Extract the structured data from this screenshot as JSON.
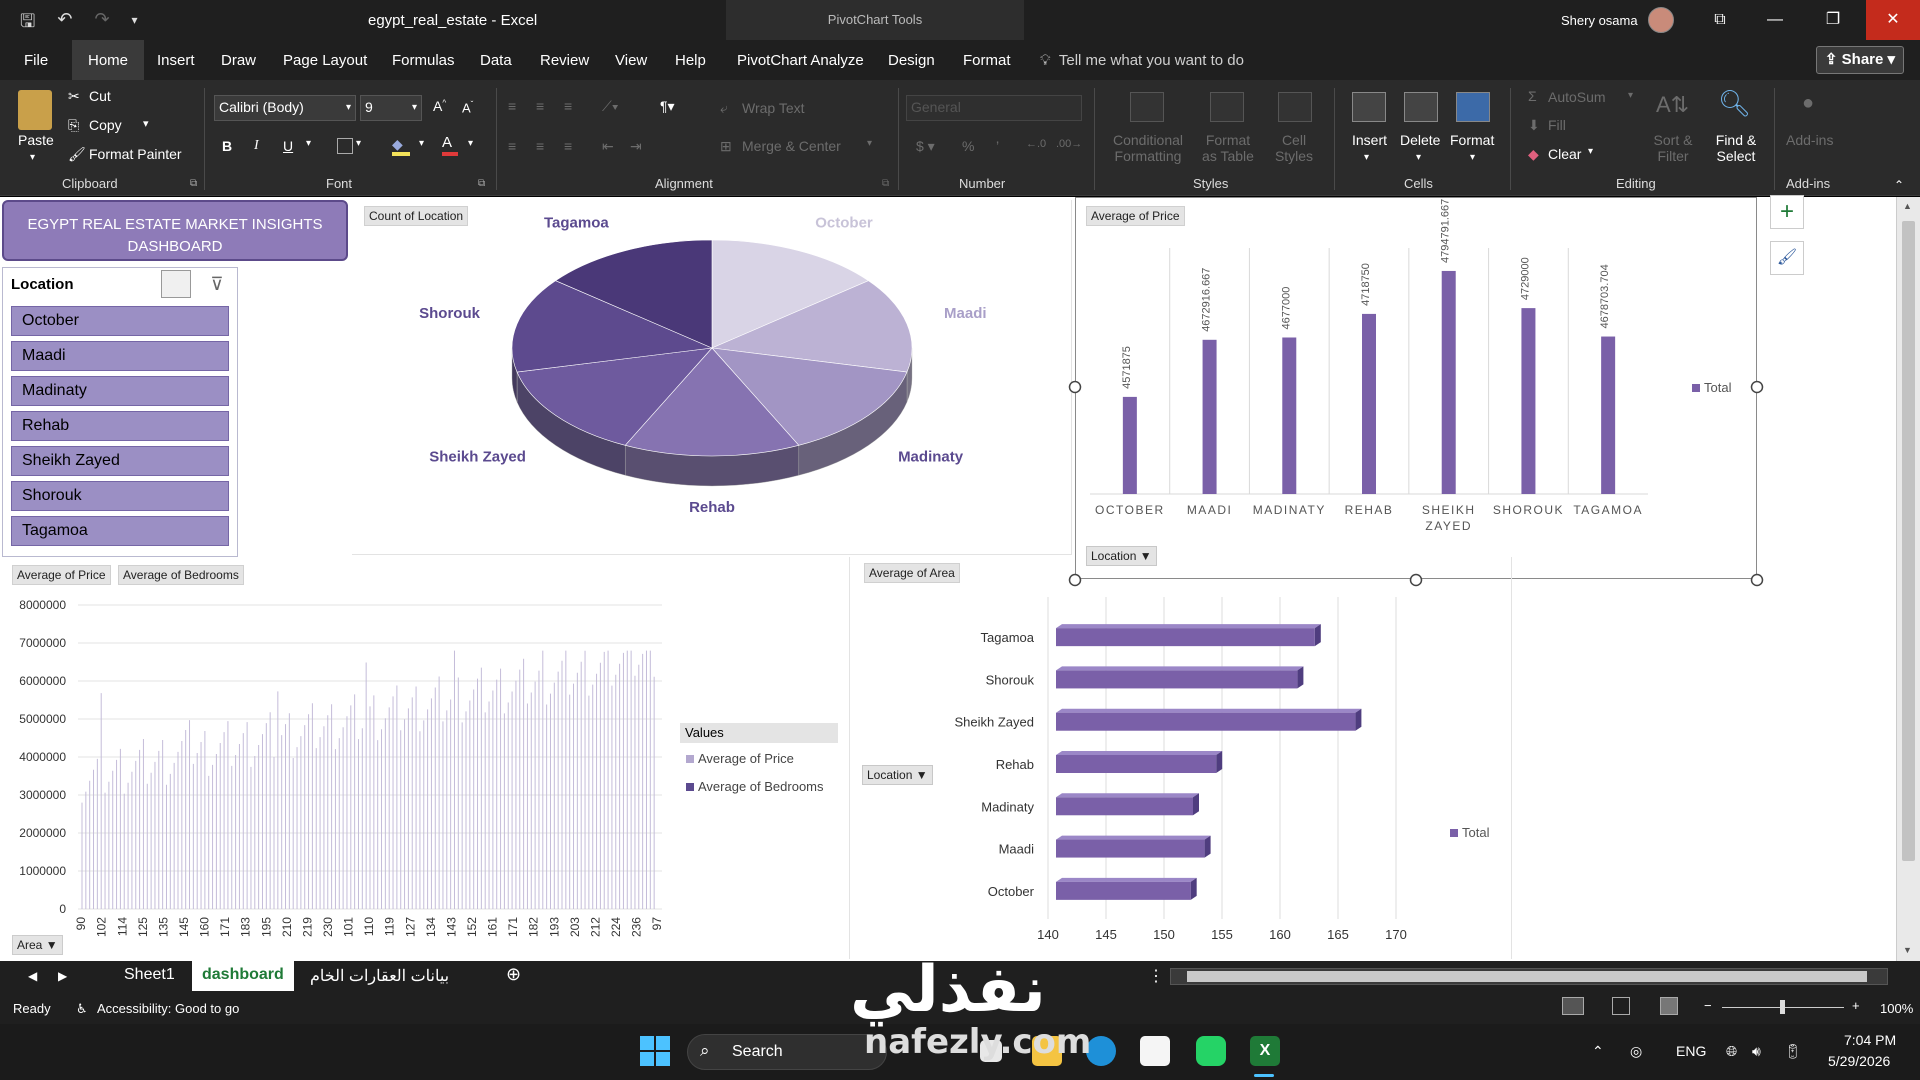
{
  "titlebar": {
    "doc_title": "egypt_real_estate  -  Excel",
    "context_title": "PivotChart Tools",
    "user": "Shery osama"
  },
  "menu": {
    "file": "File",
    "tabs": [
      "Home",
      "Insert",
      "Draw",
      "Page Layout",
      "Formulas",
      "Data",
      "Review",
      "View",
      "Help",
      "PivotChart Analyze",
      "Design",
      "Format"
    ],
    "active_tab": "Home",
    "tell_me": "Tell me what you want to do",
    "share": "Share"
  },
  "ribbon": {
    "clipboard": {
      "paste": "Paste",
      "cut": "Cut",
      "copy": "Copy",
      "format_painter": "Format Painter",
      "label": "Clipboard"
    },
    "font": {
      "name": "Calibri (Body)",
      "size": "9",
      "label": "Font",
      "bold": "B",
      "italic": "I",
      "underline": "U"
    },
    "alignment": {
      "wrap_text": "Wrap Text",
      "merge_center": "Merge & Center",
      "label": "Alignment"
    },
    "number": {
      "format": "General",
      "label": "Number"
    },
    "styles": {
      "conditional": "Conditional Formatting",
      "format_table": "Format as Table",
      "cell_styles": "Cell Styles",
      "label": "Styles"
    },
    "cells": {
      "insert": "Insert",
      "delete": "Delete",
      "format": "Format",
      "label": "Cells"
    },
    "editing": {
      "autosum": "AutoSum",
      "fill": "Fill",
      "clear": "Clear",
      "sort_filter": "Sort & Filter",
      "find_select": "Find & Select",
      "label": "Editing"
    },
    "addins": {
      "addins": "Add-ins",
      "label": "Add-ins"
    }
  },
  "dashboard": {
    "title_line1": "EGYPT REAL ESTATE MARKET INSIGHTS",
    "title_line2": "DASHBOARD"
  },
  "slicer": {
    "header": "Location",
    "items": [
      "October",
      "Maadi",
      "Madinaty",
      "Rehab",
      "Sheikh Zayed",
      "Shorouk",
      "Tagamoa"
    ]
  },
  "colors": {
    "accent": "#7a60a8",
    "slicer_fill": "#9b8fc4",
    "excel_green": "#1f7a37"
  },
  "chart_data": [
    {
      "type": "pie",
      "title": "",
      "field_button": "Count of Location",
      "categories": [
        "October",
        "Maadi",
        "Madinaty",
        "Rehab",
        "Sheikh Zayed",
        "Shorouk",
        "Tagamoa"
      ],
      "values": [
        1,
        1,
        1,
        1,
        1,
        1,
        1
      ],
      "colors": [
        "#d9d4e6",
        "#bcb2d4",
        "#a295c4",
        "#8673b1",
        "#6e5a9e",
        "#5d4a8e",
        "#4a3878"
      ]
    },
    {
      "type": "bar",
      "title": "",
      "field_button": "Average of Price",
      "axis_button": "Location",
      "categories": [
        "OCTOBER",
        "MAADI",
        "MADINATY",
        "REHAB",
        "SHEIKH ZAYED",
        "SHOROUK",
        "TAGAMOA"
      ],
      "values": [
        4571875,
        4672916.667,
        4677000,
        4718750,
        4794791.667,
        4729000,
        4678703.704
      ],
      "data_labels": [
        "4571875",
        "4672916.667",
        "4677000",
        "4718750",
        "4794791.667",
        "4729000",
        "4678703.704"
      ],
      "legend": [
        "Total"
      ],
      "legend_position": "right"
    },
    {
      "type": "bar",
      "title": "",
      "field_buttons": [
        "Average of Price",
        "Average of Bedrooms"
      ],
      "axis_button": "Area",
      "y_ticks": [
        "8000000",
        "7000000",
        "6000000",
        "5000000",
        "4000000",
        "3000000",
        "2000000",
        "1000000",
        "0"
      ],
      "ylim": [
        0,
        8000000
      ],
      "x_tick_labels": [
        "90",
        "102",
        "114",
        "125",
        "135",
        "145",
        "160",
        "171",
        "183",
        "195",
        "210",
        "219",
        "230",
        "101",
        "110",
        "119",
        "127",
        "134",
        "143",
        "152",
        "161",
        "171",
        "182",
        "193",
        "203",
        "212",
        "224",
        "236",
        "97"
      ],
      "series": [
        {
          "name": "Average of Price"
        },
        {
          "name": "Average of Bedrooms"
        }
      ],
      "legend_title": "Values",
      "legend_position": "right"
    },
    {
      "type": "bar",
      "orientation": "horizontal",
      "title": "",
      "field_button": "Average of Area",
      "axis_button": "Location",
      "categories": [
        "Tagamoa",
        "Shorouk",
        "Sheikh Zayed",
        "Rehab",
        "Madinaty",
        "Maadi",
        "October"
      ],
      "values": [
        163,
        161.5,
        166.5,
        154.5,
        152.5,
        153.5,
        152.3
      ],
      "x_ticks": [
        "140",
        "145",
        "150",
        "155",
        "160",
        "165",
        "170"
      ],
      "xlim": [
        140,
        170
      ],
      "legend": [
        "Total"
      ],
      "legend_position": "right"
    }
  ],
  "sheet_tabs": [
    "Sheet1",
    "dashboard",
    "بيانات العقارات الخام"
  ],
  "active_sheet": "dashboard",
  "status": {
    "ready": "Ready",
    "accessibility": "Accessibility: Good to go",
    "zoom": "100%"
  },
  "taskbar": {
    "search": "Search",
    "lang": "ENG",
    "time": "7:04 PM",
    "date": "5/29/2026"
  },
  "watermark": {
    "arabic": "نفذلي",
    "latin": "nafezly.com"
  }
}
